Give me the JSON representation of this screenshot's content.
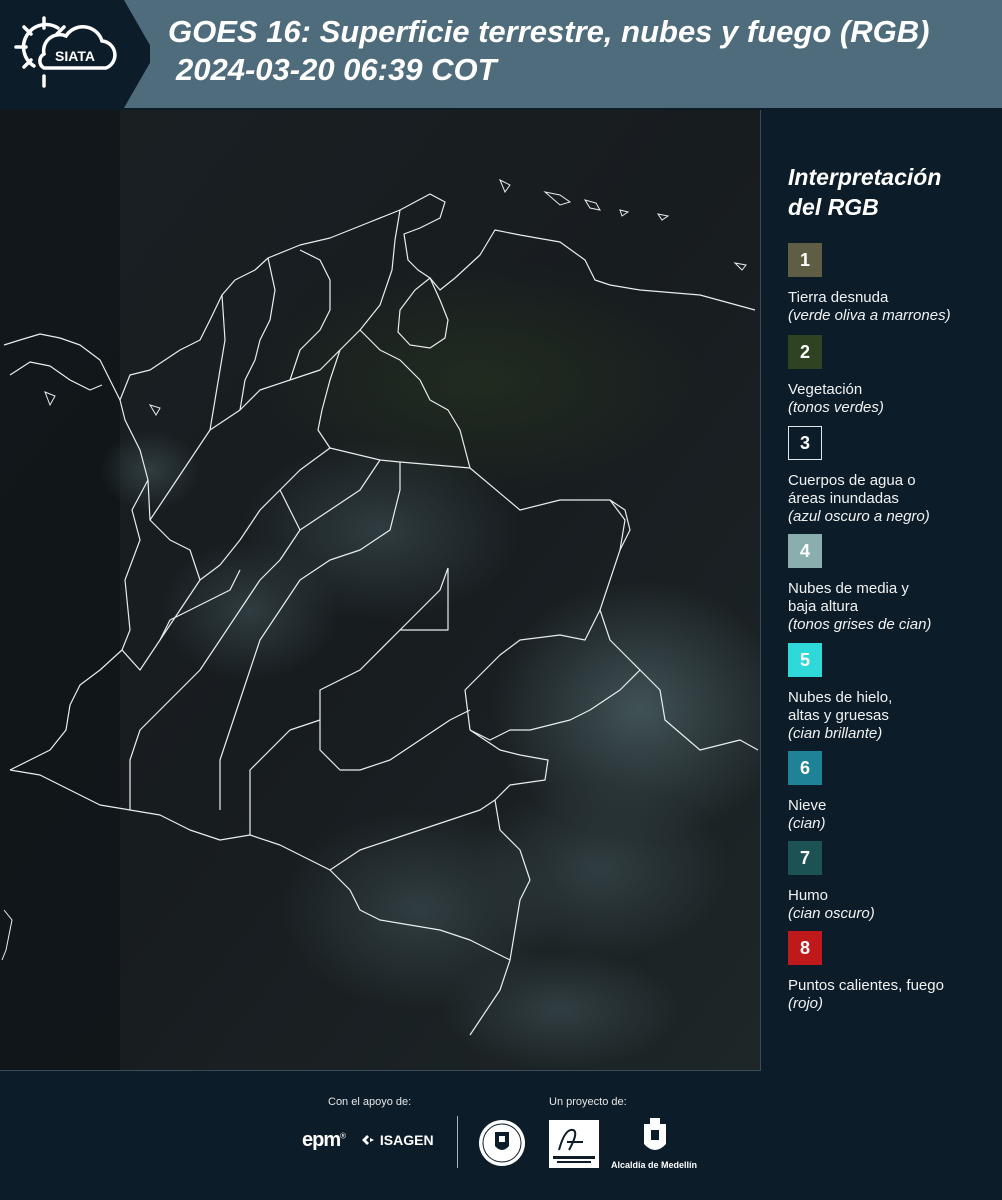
{
  "header": {
    "logo_text": "SIATA",
    "title_line1": "GOES 16: Superficie terrestre, nubes y fuego (RGB)",
    "title_line2": "2024-03-20 06:39 COT"
  },
  "legend": {
    "title_line1": "Interpretación",
    "title_line2": "del RGB",
    "items": [
      {
        "number": "1",
        "color": "#5f5e45",
        "label": "Tierra desnuda",
        "sub": "(verde oliva a marrones)"
      },
      {
        "number": "2",
        "color": "#2f4222",
        "label": "Vegetación",
        "sub": "(tonos verdes)"
      },
      {
        "number": "3",
        "color": "#0c1d29",
        "label": "Cuerpos de agua o áreas inundadas",
        "sub": "(azul oscuro a negro)"
      },
      {
        "number": "4",
        "color": "#8aaeae",
        "label": "Nubes de media y baja altura",
        "sub": "(tonos grises de cian)"
      },
      {
        "number": "5",
        "color": "#2fd9d9",
        "label": "Nubes de hielo, altas y gruesas",
        "sub": "(cian brillante)"
      },
      {
        "number": "6",
        "color": "#1f8296",
        "label": "Nieve",
        "sub": "(cian)"
      },
      {
        "number": "7",
        "color": "#1c5253",
        "label": "Humo",
        "sub": "(cian oscuro)"
      },
      {
        "number": "8",
        "color": "#c0191c",
        "label": "Puntos calientes, fuego",
        "sub": "(rojo)"
      }
    ]
  },
  "footer": {
    "support_label": "Con el apoyo de:",
    "project_label": "Un proyecto de:",
    "sponsors": [
      "epm",
      "ISAGEN"
    ],
    "alcaldia": "Alcaldía de Medellín"
  }
}
